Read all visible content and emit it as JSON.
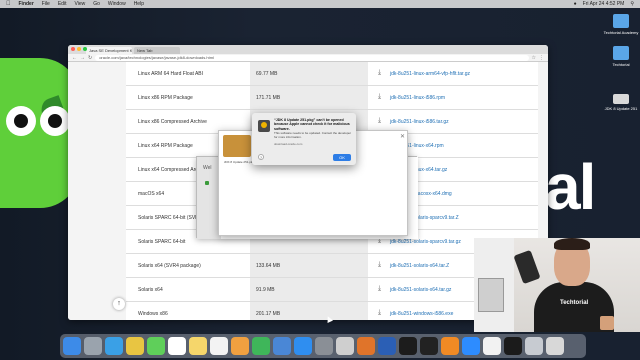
{
  "colors": {
    "brand_green": "#5fcf3a",
    "link_blue": "#1f6fb4",
    "ok_button": "#2d7de6"
  },
  "menubar": {
    "items": [
      "Finder",
      "File",
      "Edit",
      "View",
      "Go",
      "Window",
      "Help"
    ],
    "clock": "Fri Apr 24 4:52 PM"
  },
  "desktop_icons": [
    {
      "label": "Techtorial Academy",
      "icon": "folder-icon"
    },
    {
      "label": "Techtorial",
      "icon": "folder-icon"
    },
    {
      "label": "JDK 8 Update 251",
      "icon": "drive-icon"
    }
  ],
  "background_logo_text": "al",
  "browser": {
    "tabs": [
      "Java SE Development Kit 8...",
      "New Tab"
    ],
    "url": "oracle.com/java/technologies/javase/javase-jdk8-downloads.html",
    "rows": [
      {
        "name": "Linux ARM 64 Hard Float ABI",
        "size": "69.77 MB",
        "file": "jdk-8u251-linux-arm64-vfp-hflt.tar.gz"
      },
      {
        "name": "Linux x86 RPM Package",
        "size": "171.71 MB",
        "file": "jdk-8u251-linux-i586.rpm"
      },
      {
        "name": "Linux x86 Compressed Archive",
        "size": "",
        "file": "jdk-8u251-linux-i586.tar.gz"
      },
      {
        "name": "Linux x64 RPM Package",
        "size": "",
        "file": "jdk-8u251-linux-x64.rpm"
      },
      {
        "name": "Linux x64 Compressed Archive",
        "size": "",
        "file": "jdk-8u251-linux-x64.tar.gz"
      },
      {
        "name": "macOS x64",
        "size": "",
        "file": "jdk-8u251-macosx-x64.dmg"
      },
      {
        "name": "Solaris SPARC 64-bit (SVR4 package)",
        "size": "",
        "file": "jdk-8u251-solaris-sparcv9.tar.Z"
      },
      {
        "name": "Solaris SPARC 64-bit",
        "size": "",
        "file": "jdk-8u251-solaris-sparcv9.tar.gz"
      },
      {
        "name": "Solaris x64 (SVR4 package)",
        "size": "133.64 MB",
        "file": "jdk-8u251-solaris-x64.tar.Z"
      },
      {
        "name": "Solaris x64",
        "size": "91.9 MB",
        "file": "jdk-8u251-solaris-x64.tar.gz"
      },
      {
        "name": "Windows x86",
        "size": "201.17 MB",
        "file": "jdk-8u251-windows-i586.exe"
      }
    ],
    "scroll_up": "↑"
  },
  "installer": {
    "title": "Wel"
  },
  "dmg": {
    "package_label": "JDK 8 Update 251.pkg"
  },
  "alert": {
    "title": "“JDK 8 Update 251.pkg” can’t be opened because Apple cannot check it for malicious software.",
    "message": "This software needs to be updated. Contact the developer for more information.",
    "source": "download.oracle.com",
    "help": "?",
    "ok": "OK"
  },
  "webcam": {
    "shirt_text": "Techtorial"
  },
  "dock": {
    "apps": [
      {
        "icon": "finder-icon",
        "color": "#3d8be8"
      },
      {
        "icon": "launchpad-icon",
        "color": "#9aa3ad"
      },
      {
        "icon": "safari-icon",
        "color": "#3aa0e6"
      },
      {
        "icon": "chrome-icon",
        "color": "#e8c542"
      },
      {
        "icon": "messages-icon",
        "color": "#5fcf5a"
      },
      {
        "icon": "calendar-icon",
        "color": "#ffffff"
      },
      {
        "icon": "notes-icon",
        "color": "#f5d66b"
      },
      {
        "icon": "reminders-icon",
        "color": "#f3f3f3"
      },
      {
        "icon": "photos-icon",
        "color": "#f0a040"
      },
      {
        "icon": "numbers-icon",
        "color": "#3fb65a"
      },
      {
        "icon": "keynote-icon",
        "color": "#4a87d6"
      },
      {
        "icon": "app-store-icon",
        "color": "#2f8ef0"
      },
      {
        "icon": "system-preferences-icon",
        "color": "#8a8f96"
      },
      {
        "icon": "screenshot-icon",
        "color": "#cfcfcf"
      },
      {
        "icon": "firefox-icon",
        "color": "#e0742a"
      },
      {
        "icon": "word-icon",
        "color": "#2b5fb5"
      },
      {
        "icon": "intellij-icon",
        "color": "#1c1c1c"
      },
      {
        "icon": "terminal-icon",
        "color": "#222222"
      },
      {
        "icon": "sublime-icon",
        "color": "#f08a24"
      },
      {
        "icon": "zoom-icon",
        "color": "#2d8cff"
      },
      {
        "icon": "slack-icon",
        "color": "#f2f2f2"
      },
      {
        "icon": "activity-monitor-icon",
        "color": "#1b1b1b"
      },
      {
        "icon": "downloads-icon",
        "color": "#c7cbd1"
      },
      {
        "icon": "trash-icon",
        "color": "#d8d8d8"
      }
    ]
  }
}
